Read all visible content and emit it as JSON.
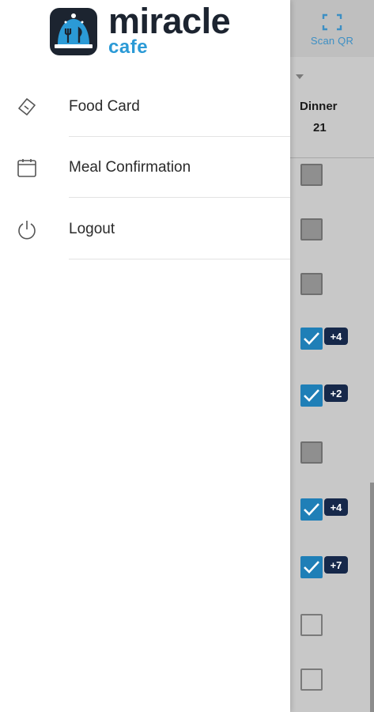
{
  "header": {
    "scan_label": "Scan QR",
    "scan_icon": "qr-scan-icon"
  },
  "brand": {
    "name": "miracle",
    "sub": "cafe",
    "colors": {
      "dark": "#1c2430",
      "accent": "#2b9ad6"
    }
  },
  "drawer": {
    "items": [
      {
        "label": "Food Card",
        "icon": "ticket-icon"
      },
      {
        "label": "Meal Confirmation",
        "icon": "calendar-icon"
      },
      {
        "label": "Logout",
        "icon": "power-icon"
      }
    ]
  },
  "background": {
    "column_title": "Dinner",
    "column_count": "21",
    "checkboxes": [
      {
        "state": "disabled",
        "badge": ""
      },
      {
        "state": "disabled",
        "badge": ""
      },
      {
        "state": "disabled",
        "badge": ""
      },
      {
        "state": "checked",
        "badge": "+4"
      },
      {
        "state": "checked",
        "badge": "+2"
      },
      {
        "state": "disabled",
        "badge": ""
      },
      {
        "state": "checked",
        "badge": "+4"
      },
      {
        "state": "checked",
        "badge": "+7"
      },
      {
        "state": "unchecked",
        "badge": ""
      },
      {
        "state": "unchecked",
        "badge": ""
      }
    ]
  }
}
